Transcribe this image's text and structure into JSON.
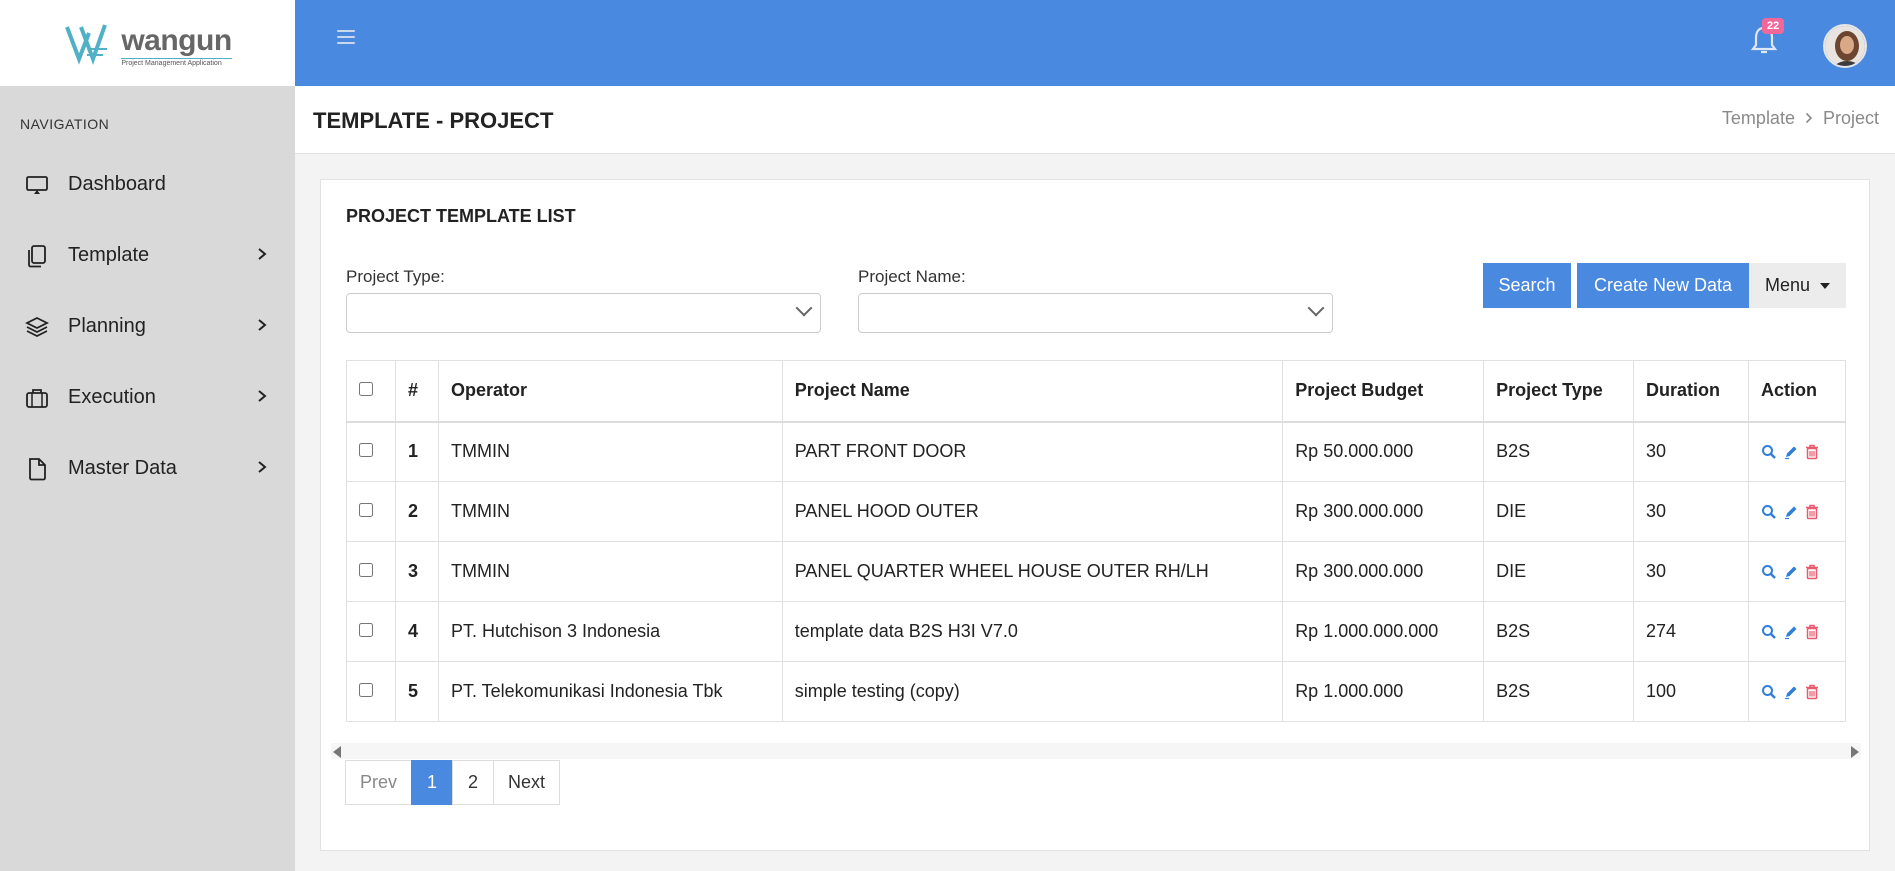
{
  "brand": {
    "name": "wangun",
    "tagline": "Project Management Application"
  },
  "sidebar": {
    "heading": "NAVIGATION",
    "items": [
      {
        "label": "Dashboard",
        "icon": "monitor-icon",
        "has_children": false
      },
      {
        "label": "Template",
        "icon": "copy-icon",
        "has_children": true
      },
      {
        "label": "Planning",
        "icon": "layers-icon",
        "has_children": true
      },
      {
        "label": "Execution",
        "icon": "briefcase-icon",
        "has_children": true
      },
      {
        "label": "Master Data",
        "icon": "file-icon",
        "has_children": true
      }
    ]
  },
  "topbar": {
    "notification_count": "22",
    "accent_color": "#4a89e0"
  },
  "header": {
    "title": "TEMPLATE - PROJECT",
    "breadcrumb": [
      "Template",
      "Project"
    ]
  },
  "card": {
    "title": "PROJECT TEMPLATE LIST",
    "filters": {
      "project_type_label": "Project Type:",
      "project_type_value": "",
      "project_name_label": "Project Name:",
      "project_name_value": ""
    },
    "buttons": {
      "search": "Search",
      "create": "Create New Data",
      "menu": "Menu"
    }
  },
  "table": {
    "columns": [
      "#",
      "Operator",
      "Project Name",
      "Project Budget",
      "Project Type",
      "Duration",
      "Action"
    ],
    "rows": [
      {
        "no": "1",
        "operator": "TMMIN",
        "project_name": "PART FRONT DOOR",
        "budget": "Rp 50.000.000",
        "type": "B2S",
        "duration": "30"
      },
      {
        "no": "2",
        "operator": "TMMIN",
        "project_name": "PANEL HOOD OUTER",
        "budget": "Rp 300.000.000",
        "type": "DIE",
        "duration": "30"
      },
      {
        "no": "3",
        "operator": "TMMIN",
        "project_name": "PANEL QUARTER WHEEL HOUSE OUTER RH/LH",
        "budget": "Rp 300.000.000",
        "type": "DIE",
        "duration": "30"
      },
      {
        "no": "4",
        "operator": "PT. Hutchison 3 Indonesia",
        "project_name": "template data B2S H3I V7.0",
        "budget": "Rp 1.000.000.000",
        "type": "B2S",
        "duration": "274"
      },
      {
        "no": "5",
        "operator": "PT. Telekomunikasi Indonesia Tbk",
        "project_name": "simple testing (copy)",
        "budget": "Rp 1.000.000",
        "type": "B2S",
        "duration": "100"
      }
    ]
  },
  "pagination": {
    "prev": "Prev",
    "pages": [
      "1",
      "2"
    ],
    "active": "1",
    "next": "Next"
  }
}
